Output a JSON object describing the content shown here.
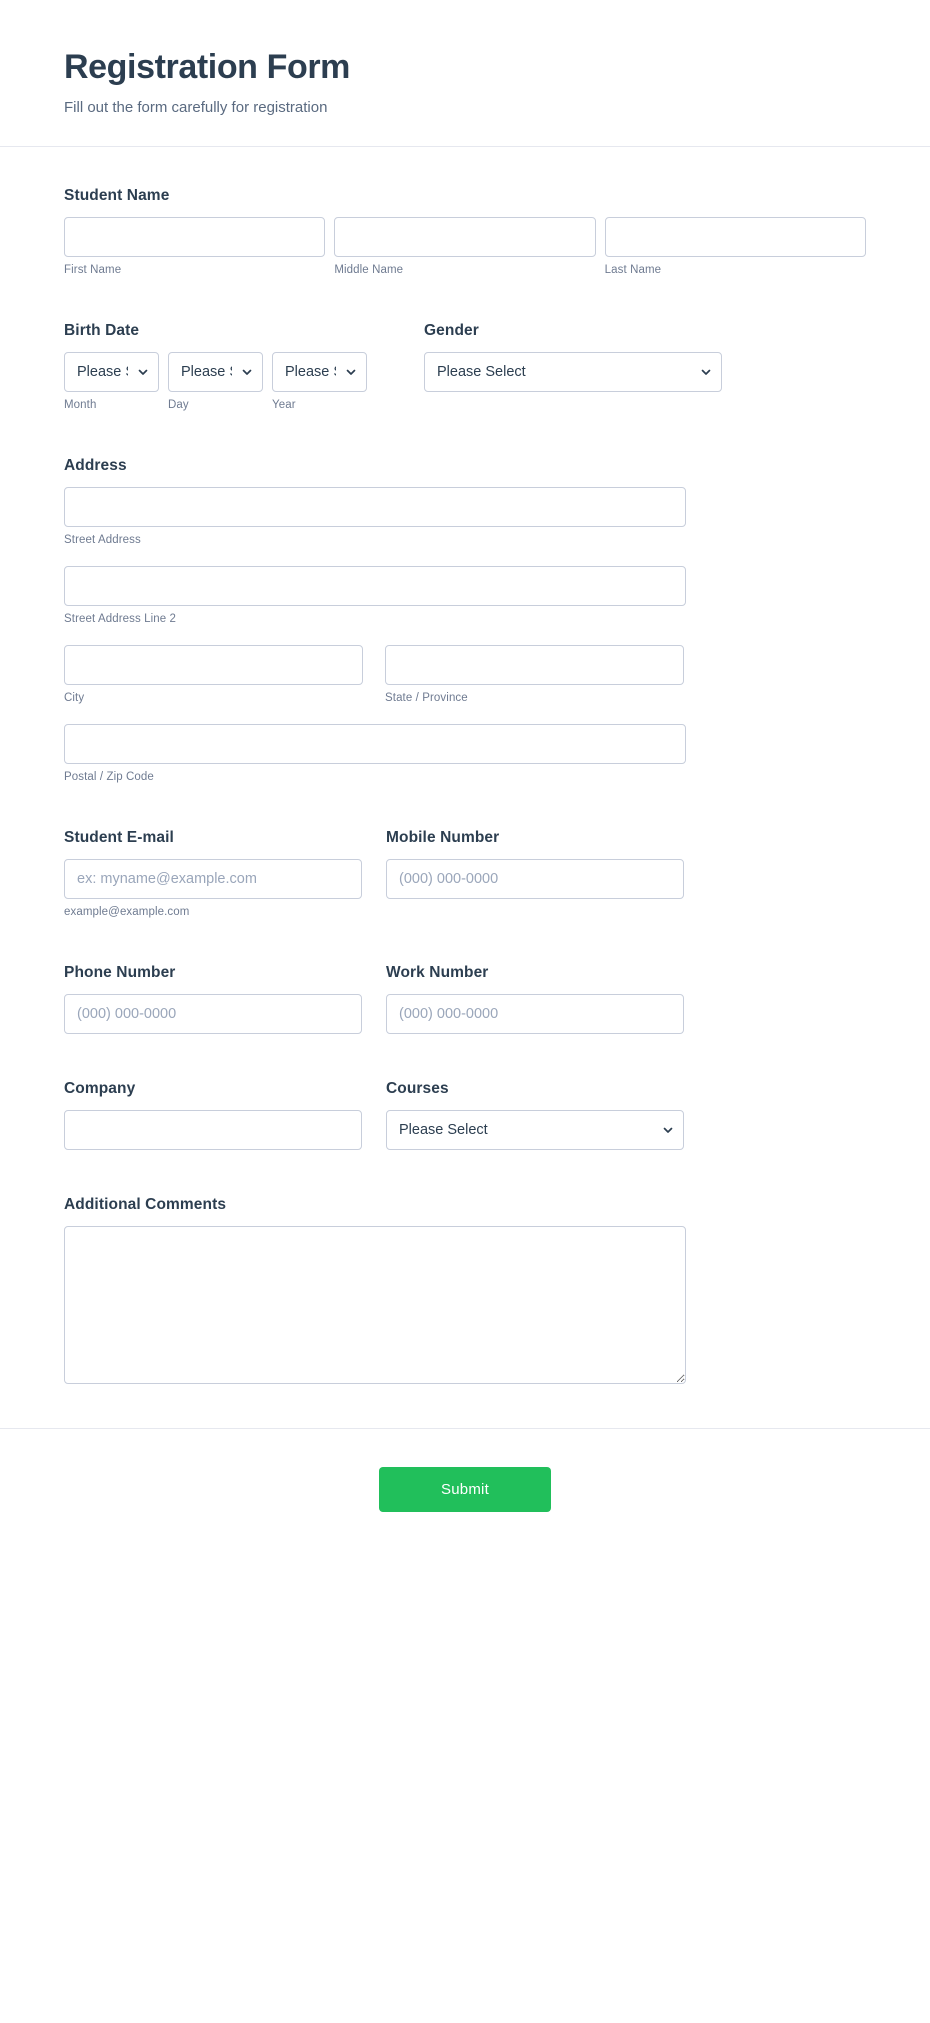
{
  "header": {
    "title": "Registration Form",
    "subtitle": "Fill out the form carefully for registration"
  },
  "colors": {
    "submit_green": "#21bf5b",
    "label_navy": "#2c3e50",
    "sublabel_gray": "#6f7b91",
    "border_gray": "#c8cedb",
    "divider": "#e6e8ef"
  },
  "fields": {
    "student_name": {
      "label": "Student Name",
      "parts": [
        {
          "value": "",
          "placeholder": "",
          "sublabel": "First Name"
        },
        {
          "value": "",
          "placeholder": "",
          "sublabel": "Middle Name"
        },
        {
          "value": "",
          "placeholder": "",
          "sublabel": "Last Name"
        }
      ]
    },
    "birth_date": {
      "label": "Birth Date",
      "parts": [
        {
          "value": "Please Select",
          "sublabel": "Month",
          "options": [
            "Please Select"
          ]
        },
        {
          "value": "Please Select",
          "sublabel": "Day",
          "options": [
            "Please Select"
          ]
        },
        {
          "value": "Please Select",
          "sublabel": "Year",
          "options": [
            "Please Select"
          ]
        }
      ]
    },
    "gender": {
      "label": "Gender",
      "value": "Please Select",
      "options": [
        "Please Select"
      ]
    },
    "address": {
      "label": "Address",
      "street": {
        "value": "",
        "placeholder": "",
        "sublabel": "Street Address"
      },
      "street2": {
        "value": "",
        "placeholder": "",
        "sublabel": "Street Address Line 2"
      },
      "city": {
        "value": "",
        "placeholder": "",
        "sublabel": "City"
      },
      "state": {
        "value": "",
        "placeholder": "",
        "sublabel": "State / Province"
      },
      "postal": {
        "value": "",
        "placeholder": "",
        "sublabel": "Postal / Zip Code"
      }
    },
    "student_email": {
      "label": "Student E-mail",
      "value": "",
      "placeholder": "ex: myname@example.com",
      "sublabel": "example@example.com"
    },
    "mobile_number": {
      "label": "Mobile Number",
      "value": "",
      "placeholder": "(000) 000-0000"
    },
    "phone_number": {
      "label": "Phone Number",
      "value": "",
      "placeholder": "(000) 000-0000"
    },
    "work_number": {
      "label": "Work Number",
      "value": "",
      "placeholder": "(000) 000-0000"
    },
    "company": {
      "label": "Company",
      "value": "",
      "placeholder": ""
    },
    "courses": {
      "label": "Courses",
      "value": "Please Select",
      "options": [
        "Please Select"
      ]
    },
    "additional_comments": {
      "label": "Additional Comments",
      "value": "",
      "placeholder": ""
    }
  },
  "footer": {
    "submit_label": "Submit"
  },
  "icons": {
    "chevron_down": "chevron-down-icon"
  }
}
